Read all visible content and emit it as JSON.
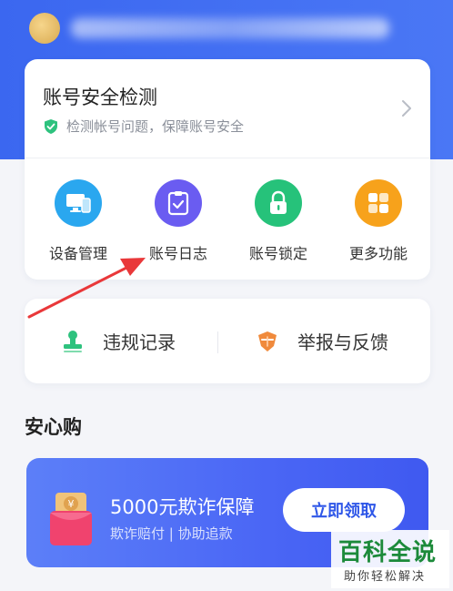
{
  "security_card": {
    "title": "账号安全检测",
    "subtitle": "检测帐号问题，保障账号安全",
    "functions": [
      {
        "label": "设备管理",
        "icon": "device-icon",
        "color": "#2aa7ef"
      },
      {
        "label": "账号日志",
        "icon": "log-icon",
        "color": "#6a5cf1"
      },
      {
        "label": "账号锁定",
        "icon": "lock-icon",
        "color": "#26c27a"
      },
      {
        "label": "更多功能",
        "icon": "grid-icon",
        "color": "#f7a21b"
      }
    ]
  },
  "actions": {
    "violation": "违规记录",
    "report": "举报与反馈"
  },
  "section": {
    "title": "安心购"
  },
  "banner": {
    "title": "5000元欺诈保障",
    "subtitle": "欺诈赔付 | 协助追款",
    "button": "立即领取",
    "coin_symbol": "¥"
  },
  "watermark": {
    "main": "百科全说",
    "sub": "助你轻松解决"
  },
  "colors": {
    "brand_blue": "#3b67f0",
    "check_green": "#2ec27e"
  }
}
